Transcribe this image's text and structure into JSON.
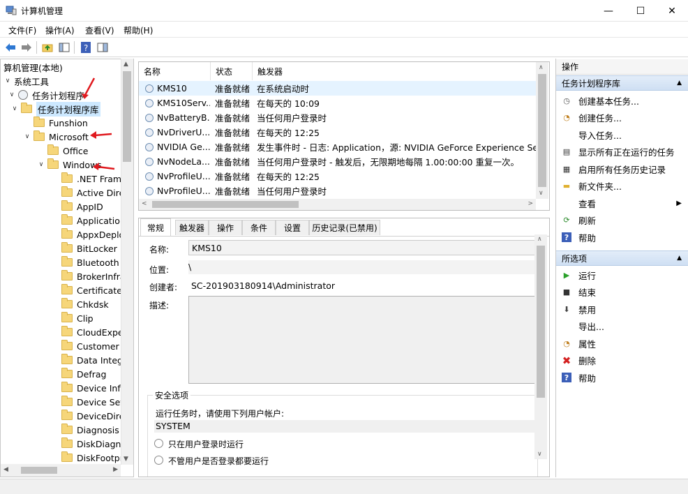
{
  "window": {
    "title": "计算机管理",
    "minimize": "—",
    "maximize": "☐",
    "close": "✕"
  },
  "menu": [
    "文件(F)",
    "操作(A)",
    "查看(V)",
    "帮助(H)"
  ],
  "tree": {
    "root": "算机管理(本地)",
    "system_tools": "系统工具",
    "task_scheduler": "任务计划程序",
    "library": "任务计划程序库",
    "funshion": "Funshion",
    "microsoft": "Microsoft",
    "office": "Office",
    "windows": "Windows",
    "children": [
      ".NET Frame",
      "Active Direc",
      "AppID",
      "Application",
      "AppxDeplo",
      "BitLocker",
      "Bluetooth",
      "BrokerInfra",
      "CertificateS",
      "Chkdsk",
      "Clip",
      "CloudExper",
      "Customer E",
      "Data Integr",
      "Defrag",
      "Device Info",
      "Device Setu",
      "DeviceDirec",
      "Diagnosis",
      "DiskDiagno",
      "DiskFootpr"
    ]
  },
  "task_list": {
    "headers": [
      "名称",
      "状态",
      "触发器"
    ],
    "rows": [
      {
        "name": "KMS10",
        "status": "准备就绪",
        "trigger": "在系统启动时"
      },
      {
        "name": "KMS10Serv...",
        "status": "准备就绪",
        "trigger": "在每天的 10:09"
      },
      {
        "name": "NvBatteryB...",
        "status": "准备就绪",
        "trigger": "当任何用户登录时"
      },
      {
        "name": "NvDriverU...",
        "status": "准备就绪",
        "trigger": "在每天的 12:25"
      },
      {
        "name": "NVIDIA Ge...",
        "status": "准备就绪",
        "trigger": "发生事件时 - 日志: Application，源: NVIDIA GeForce Experience SelfUp"
      },
      {
        "name": "NvNodeLa...",
        "status": "准备就绪",
        "trigger": "当任何用户登录时 - 触发后，无限期地每隔 1.00:00:00 重复一次。"
      },
      {
        "name": "NvProfileU...",
        "status": "准备就绪",
        "trigger": "在每天的 12:25"
      },
      {
        "name": "NvProfileU...",
        "status": "准备就绪",
        "trigger": "当任何用户登录时"
      }
    ]
  },
  "detail": {
    "tabs": [
      "常规",
      "触发器",
      "操作",
      "条件",
      "设置",
      "历史记录(已禁用)"
    ],
    "name_label": "名称:",
    "name_value": "KMS10",
    "location_label": "位置:",
    "location_value": "\\",
    "author_label": "创建者:",
    "author_value": "SC-201903180914\\Administrator",
    "desc_label": "描述:",
    "security_label": "安全选项",
    "run_as_label": "运行任务时，请使用下列用户帐户:",
    "run_as_value": "SYSTEM",
    "opt1": "只在用户登录时运行",
    "opt2": "不管用户是否登录都要运行"
  },
  "actions": {
    "header": "操作",
    "section1": "任务计划程序库",
    "items1": [
      {
        "label": "创建基本任务...",
        "icon": "create-basic-task-icon"
      },
      {
        "label": "创建任务...",
        "icon": "create-task-icon"
      },
      {
        "label": "导入任务...",
        "icon": ""
      },
      {
        "label": "显示所有正在运行的任务",
        "icon": "running-tasks-icon"
      },
      {
        "label": "启用所有任务历史记录",
        "icon": "history-icon"
      },
      {
        "label": "新文件夹...",
        "icon": "new-folder-icon"
      },
      {
        "label": "查看",
        "icon": ""
      },
      {
        "label": "刷新",
        "icon": "refresh-icon"
      },
      {
        "label": "帮助",
        "icon": "help-icon"
      }
    ],
    "section2": "所选项",
    "items2": [
      {
        "label": "运行",
        "icon": "run-icon"
      },
      {
        "label": "结束",
        "icon": "stop-icon"
      },
      {
        "label": "禁用",
        "icon": "disable-icon"
      },
      {
        "label": "导出...",
        "icon": ""
      },
      {
        "label": "属性",
        "icon": "properties-icon"
      },
      {
        "label": "删除",
        "icon": "delete-icon"
      },
      {
        "label": "帮助",
        "icon": "help-icon"
      }
    ]
  },
  "colors": {
    "accent": "#1a73c8",
    "selection": "#cce8ff",
    "annotation_arrow": "#e0191e"
  }
}
